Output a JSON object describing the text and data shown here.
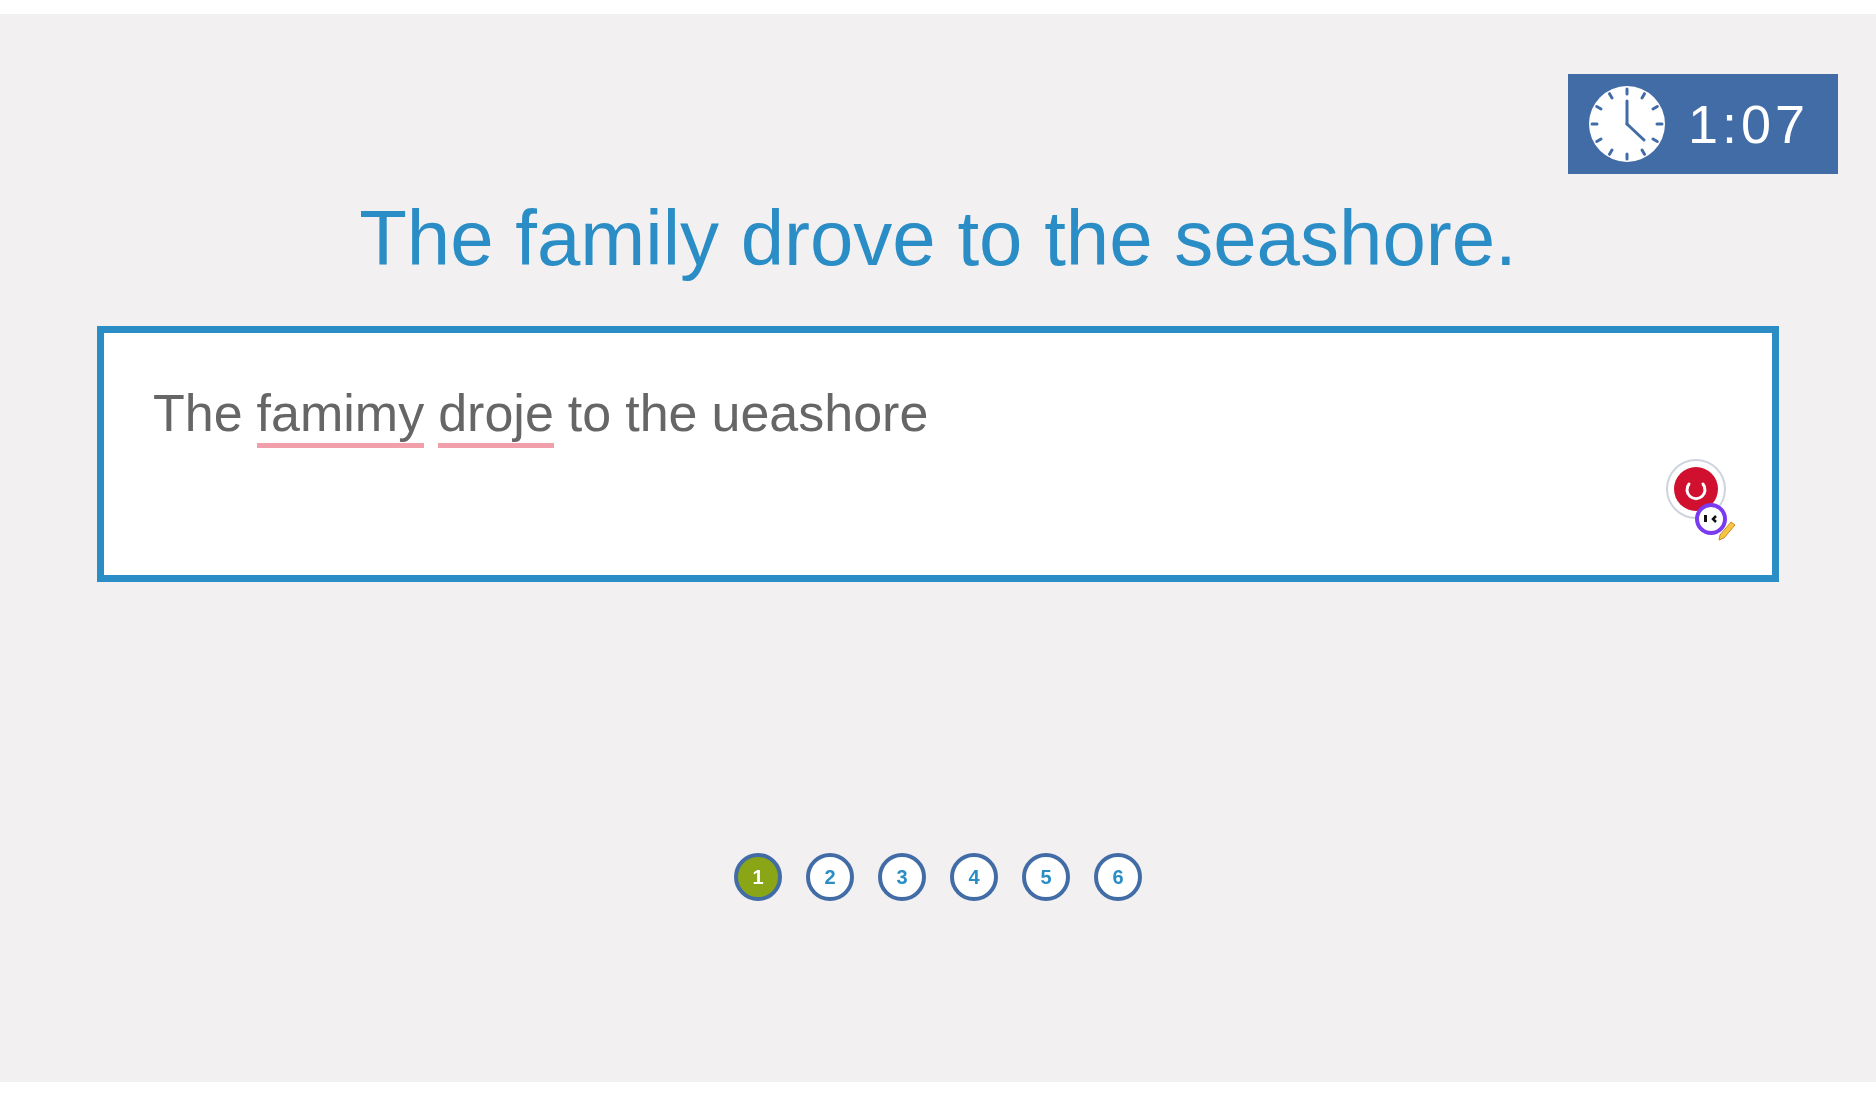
{
  "timer": {
    "time": "1:07"
  },
  "prompt": "The family drove to the seashore.",
  "answer": {
    "words": [
      {
        "text": "The",
        "misspelled": false
      },
      {
        "text": "famimy",
        "misspelled": true
      },
      {
        "text": "droje",
        "misspelled": true
      },
      {
        "text": "to",
        "misspelled": false
      },
      {
        "text": "the",
        "misspelled": false
      },
      {
        "text": "ueashore",
        "misspelled": false
      }
    ]
  },
  "pages": [
    {
      "label": "1",
      "selected": true
    },
    {
      "label": "2",
      "selected": false
    },
    {
      "label": "3",
      "selected": false
    },
    {
      "label": "4",
      "selected": false
    },
    {
      "label": "5",
      "selected": false
    },
    {
      "label": "6",
      "selected": false
    }
  ]
}
